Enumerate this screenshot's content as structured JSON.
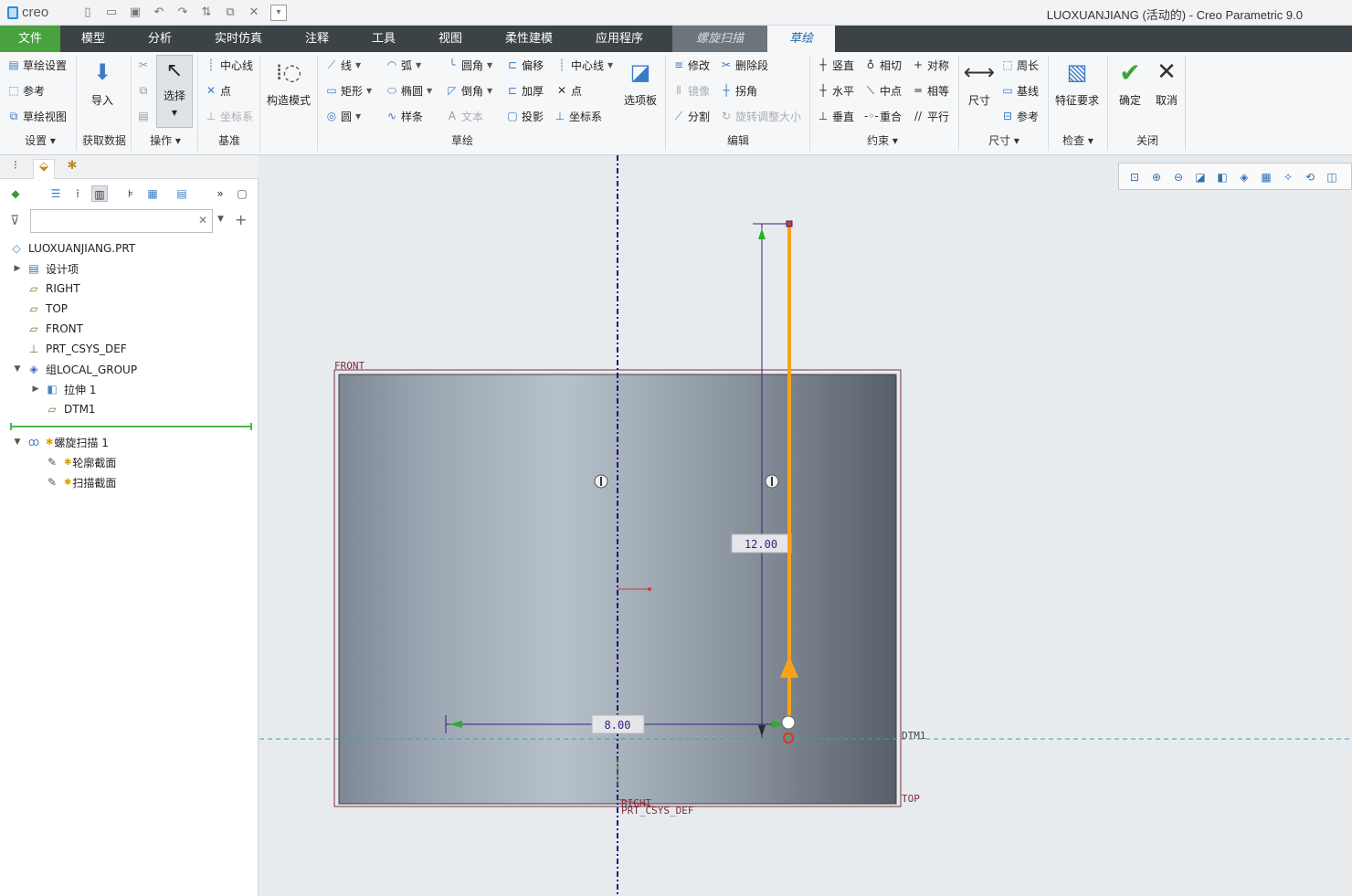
{
  "app": {
    "logo": "creo",
    "title": "LUOXUANJIANG (活动的) - Creo Parametric 9.0"
  },
  "quick_access": {
    "icons": [
      "new-file-icon",
      "open-icon",
      "save-icon",
      "undo-icon",
      "redo-icon",
      "regenerate-icon",
      "window-icon",
      "close-window-icon",
      "customize-dropdown-icon"
    ]
  },
  "menu": {
    "tabs": [
      "文件",
      "模型",
      "分析",
      "实时仿真",
      "注释",
      "工具",
      "视图",
      "柔性建模",
      "应用程序",
      "螺旋扫描",
      "草绘"
    ]
  },
  "ribbon": {
    "setup": {
      "label": "设置",
      "items": [
        "草绘设置",
        "参考",
        "草绘视图"
      ]
    },
    "get_data": {
      "label": "获取数据",
      "import": "导入"
    },
    "operations": {
      "label": "操作",
      "select": "选择"
    },
    "datum": {
      "label": "基准",
      "items": [
        "中心线",
        "点",
        "坐标系"
      ]
    },
    "construction": {
      "label": "构造模式"
    },
    "sketch": {
      "label": "草绘",
      "items": [
        "线",
        "弧",
        "圆角",
        "偏移",
        "中心线",
        "矩形",
        "椭圆",
        "倒角",
        "加厚",
        "点",
        "圆",
        "样条",
        "文本",
        "投影",
        "坐标系"
      ],
      "palette": "选项板"
    },
    "edit": {
      "label": "编辑",
      "items": [
        "修改",
        "删除段",
        "镜像",
        "拐角",
        "分割",
        "旋转调整大小"
      ]
    },
    "constrain": {
      "label": "约束",
      "items": [
        "竖直",
        "相切",
        "对称",
        "水平",
        "中点",
        "相等",
        "垂直",
        "重合",
        "平行"
      ]
    },
    "dimension": {
      "label": "尺寸",
      "dim": "尺寸",
      "items": [
        "周长",
        "基线",
        "参考"
      ]
    },
    "inspect": {
      "label": "检查",
      "feature_req": "特征要求"
    },
    "close": {
      "label": "关闭",
      "ok": "确定",
      "cancel": "取消"
    }
  },
  "model_tree": {
    "search_placeholder": "",
    "root": "LUOXUANJIANG.PRT",
    "items": [
      "设计项",
      "RIGHT",
      "TOP",
      "FRONT",
      "PRT_CSYS_DEF",
      "组LOCAL_GROUP",
      "拉伸 1",
      "DTM1",
      "螺旋扫描 1",
      "轮廓截面",
      "扫描截面"
    ]
  },
  "viewport": {
    "labels": {
      "front": "FRONT",
      "top": "TOP",
      "dtm1": "DTM1",
      "right": "RIGHT",
      "csys": "PRT_CSYS_DEF"
    },
    "dims": {
      "height": "12.00",
      "width": "8.00"
    },
    "colors": {
      "profile": "#f7a21b",
      "dimension": "#3a1e7a",
      "centerline": "#23127a",
      "datum": "#7a2d3a"
    }
  }
}
